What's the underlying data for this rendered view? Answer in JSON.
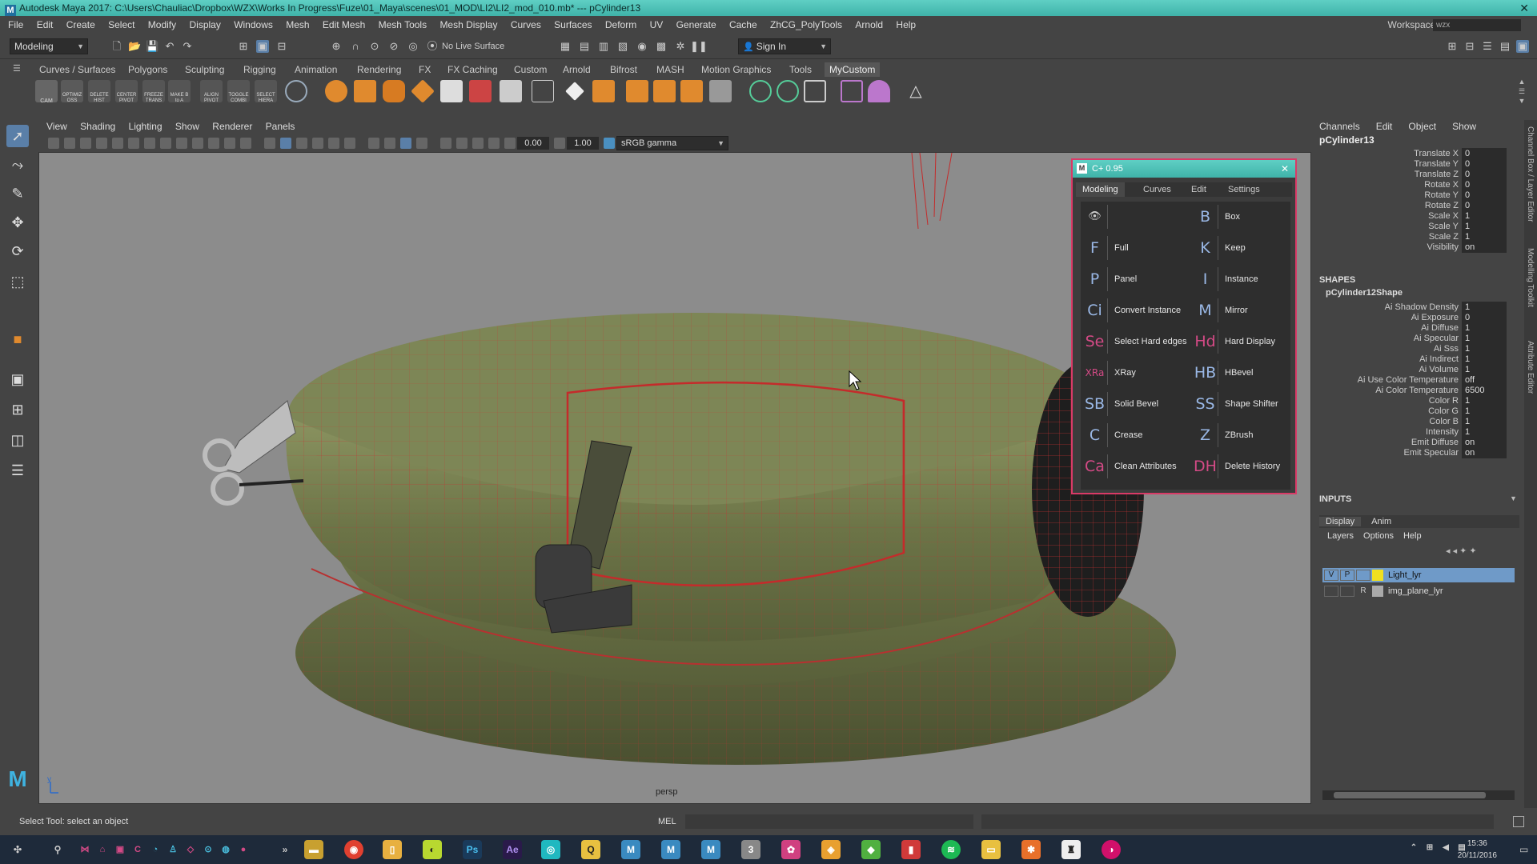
{
  "window": {
    "title": "Autodesk Maya 2017: C:\\Users\\Chauliac\\Dropbox\\WZX\\Works In Progress\\Fuze\\01_Maya\\scenes\\01_MOD\\LI2\\LI2_mod_010.mb* --- pCylinder13",
    "app_icon": "M",
    "close": "✕"
  },
  "menubar": {
    "items": [
      "File",
      "Edit",
      "Create",
      "Select",
      "Modify",
      "Display",
      "Windows",
      "Mesh",
      "Edit Mesh",
      "Mesh Tools",
      "Mesh Display",
      "Curves",
      "Surfaces",
      "Deform",
      "UV",
      "Generate",
      "Cache",
      "ZhCG_PolyTools",
      "Arnold",
      "Help"
    ],
    "workspace_label": "Workspace :",
    "workspace_value": "wzx"
  },
  "statusline": {
    "mode": "Modeling",
    "live_surface": "No Live Surface",
    "sign_in": "Sign In"
  },
  "shelf": {
    "tabs": [
      "Curves / Surfaces",
      "Polygons",
      "Sculpting",
      "Rigging",
      "Animation",
      "Rendering",
      "FX",
      "FX Caching",
      "Custom",
      "Arnold",
      "Bifrost",
      "MASH",
      "Motion Graphics",
      "Tools",
      "MyCustom"
    ],
    "active_tab": "MyCustom",
    "small_labels": [
      "CAM",
      "OPTIMIZ OSS",
      "DELETE HIST",
      "CENTER PIVOT",
      "FREEZE TRANS",
      "MAKE B to A",
      "ALIGN PIVOT",
      "TOGGLE COMBI",
      "SELECT HIERA"
    ]
  },
  "viewport": {
    "menu": [
      "View",
      "Shading",
      "Lighting",
      "Show",
      "Renderer",
      "Panels"
    ],
    "exposure": "0.00",
    "gamma": "1.00",
    "color_space": "sRGB gamma",
    "camera": "persp",
    "axis_y": "y"
  },
  "panel_window": {
    "title": "C+ 0.95",
    "tabs": [
      "Modeling",
      "Curves",
      "Edit",
      "Settings"
    ],
    "active_tab": "Modeling",
    "left": [
      {
        "glyph": "👁",
        "label": ""
      },
      {
        "glyph": "F",
        "label": "Full"
      },
      {
        "glyph": "P",
        "label": "Panel"
      },
      {
        "glyph": "Ci",
        "label": "Convert Instance"
      },
      {
        "glyph": "Se",
        "label": "Select Hard edges"
      },
      {
        "glyph": "XRa",
        "label": "XRay"
      },
      {
        "glyph": "SB",
        "label": "Solid Bevel"
      },
      {
        "glyph": "C",
        "label": "Crease"
      },
      {
        "glyph": "Ca",
        "label": "Clean Attributes"
      }
    ],
    "right": [
      {
        "glyph": "B",
        "label": "Box"
      },
      {
        "glyph": "K",
        "label": "Keep"
      },
      {
        "glyph": "I",
        "label": "Instance"
      },
      {
        "glyph": "M",
        "label": "Mirror"
      },
      {
        "glyph": "Hd",
        "label": "Hard Display"
      },
      {
        "glyph": "HB",
        "label": "HBevel"
      },
      {
        "glyph": "SS",
        "label": "Shape Shifter"
      },
      {
        "glyph": "Z",
        "label": "ZBrush"
      },
      {
        "glyph": "DH",
        "label": "Delete History"
      }
    ]
  },
  "channel_box": {
    "menu": [
      "Channels",
      "Edit",
      "Object",
      "Show"
    ],
    "object": "pCylinder13",
    "transform": [
      {
        "name": "Translate X",
        "value": "0"
      },
      {
        "name": "Translate Y",
        "value": "0"
      },
      {
        "name": "Translate Z",
        "value": "0"
      },
      {
        "name": "Rotate X",
        "value": "0"
      },
      {
        "name": "Rotate Y",
        "value": "0"
      },
      {
        "name": "Rotate Z",
        "value": "0"
      },
      {
        "name": "Scale X",
        "value": "1"
      },
      {
        "name": "Scale Y",
        "value": "1"
      },
      {
        "name": "Scale Z",
        "value": "1"
      },
      {
        "name": "Visibility",
        "value": "on"
      }
    ],
    "shapes_header": "SHAPES",
    "shape_name": "pCylinder12Shape",
    "shape_attrs": [
      {
        "name": "Ai Shadow Density",
        "value": "1"
      },
      {
        "name": "Ai Exposure",
        "value": "0"
      },
      {
        "name": "Ai Diffuse",
        "value": "1"
      },
      {
        "name": "Ai Specular",
        "value": "1"
      },
      {
        "name": "Ai Sss",
        "value": "1"
      },
      {
        "name": "Ai Indirect",
        "value": "1"
      },
      {
        "name": "Ai Volume",
        "value": "1"
      },
      {
        "name": "Ai Use Color Temperature",
        "value": "off"
      },
      {
        "name": "Ai Color Temperature",
        "value": "6500"
      },
      {
        "name": "Color R",
        "value": "1"
      },
      {
        "name": "Color G",
        "value": "1"
      },
      {
        "name": "Color B",
        "value": "1"
      },
      {
        "name": "Intensity",
        "value": "1"
      },
      {
        "name": "Emit Diffuse",
        "value": "on"
      },
      {
        "name": "Emit Specular",
        "value": "on"
      }
    ],
    "inputs_header": "INPUTS"
  },
  "layers": {
    "tabs": [
      "Display",
      "Anim"
    ],
    "menu": [
      "Layers",
      "Options",
      "Help"
    ],
    "rows": [
      {
        "v": "V",
        "p": "P",
        "r": "",
        "name": "Light_lyr",
        "color": "#f0e020",
        "selected": true
      },
      {
        "v": "",
        "p": "",
        "r": "R",
        "name": "img_plane_lyr",
        "color": "#aaaaaa",
        "selected": false
      }
    ]
  },
  "side_tabs": [
    "Channel Box / Layer Editor",
    "Modelling Toolkit",
    "Attribute Editor"
  ],
  "helpline": {
    "text": "Select Tool: select an object",
    "mel": "MEL"
  },
  "taskbar": {
    "time": "15:36",
    "date": "20/11/2016"
  }
}
